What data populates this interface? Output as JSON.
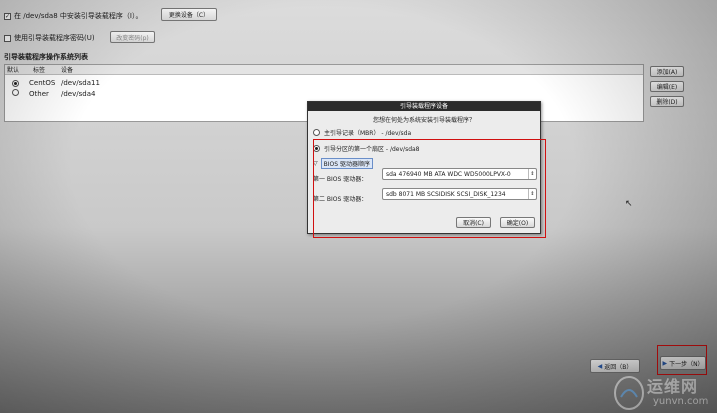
{
  "top": {
    "install_bootloader_label": "在 /dev/sda8 中安装引导装载程序（I）。",
    "change_device_button": "更换设备（C）",
    "use_password_label": "使用引导装载程序密码(U)",
    "change_password_button": "改变密码(p)"
  },
  "bootloader_list": {
    "section_title": "引导装载程序操作系统列表",
    "columns": [
      "默认",
      "标签",
      "设备"
    ],
    "rows": [
      {
        "label": "CentOS",
        "device": "/dev/sda11",
        "default": true
      },
      {
        "label": "Other",
        "device": "/dev/sda4",
        "default": false
      }
    ]
  },
  "side_buttons": {
    "add": "添加(A)",
    "edit": "编辑(E)",
    "delete": "删除(D)"
  },
  "dialog": {
    "title": "引导装载程序设备",
    "prompt": "您想在何处为系统安装引导装载程序？",
    "option_mbr": "主引导记录（MBR） - /dev/sda",
    "option_first_sector": "引导分区的第一个扇区 - /dev/sda8",
    "bios_order_label": "BIOS 驱动器顺序",
    "first_bios_label": "第一 BIOS 驱动器：",
    "first_bios_value": "sda   476940 MB ATA WDC WD5000LPVX-0",
    "second_bios_label": "第二 BIOS 驱动器：",
    "second_bios_value": "sdb    8071 MB SCSIDISK SCSI_DISK_1234",
    "cancel_button": "取消(C)",
    "ok_button": "确定(O)"
  },
  "nav": {
    "back_button": "返回（B）",
    "next_button": "下一步（N）"
  },
  "watermark": {
    "brand_cn": "运维网",
    "domain": "yunvn.com"
  },
  "colors": {
    "annotation_red": "#d01010",
    "dialog_titlebar": "#2b2b2b"
  }
}
